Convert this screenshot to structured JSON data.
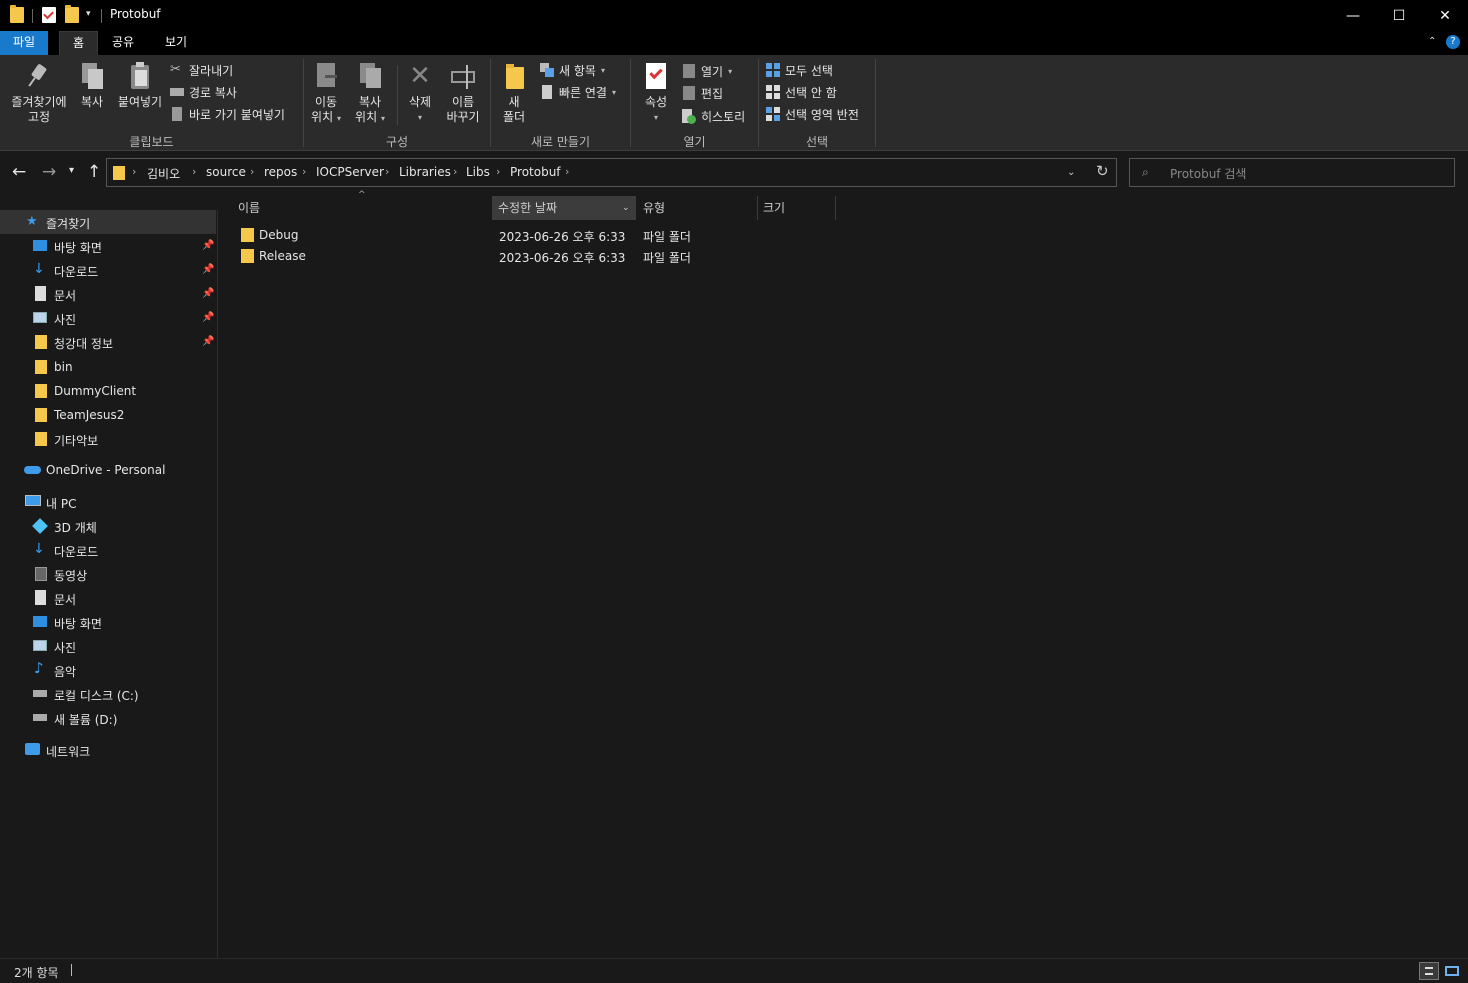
{
  "window": {
    "title": "Protobuf"
  },
  "tabs": [
    "파일",
    "홈",
    "공유",
    "보기"
  ],
  "ribbon": {
    "clipboard": {
      "pin_line1": "즐겨찾기에",
      "pin_line2": "고정",
      "copy": "복사",
      "paste": "붙여넣기",
      "cut": "잘라내기",
      "copy_path": "경로 복사",
      "paste_shortcut": "바로 가기 붙여넣기",
      "label": "클립보드"
    },
    "organize": {
      "move_line1": "이동",
      "move_line2": "위치",
      "copyto_line1": "복사",
      "copyto_line2": "위치",
      "delete": "삭제",
      "rename_line1": "이름",
      "rename_line2": "바꾸기",
      "label": "구성"
    },
    "new": {
      "folder_line1": "새",
      "folder_line2": "폴더",
      "new_item": "새 항목",
      "easy_access": "빠른 연결",
      "label": "새로 만들기"
    },
    "open": {
      "properties": "속성",
      "open": "열기",
      "edit": "편집",
      "history": "히스토리",
      "label": "열기"
    },
    "select": {
      "select_all": "모두 선택",
      "select_none": "선택 안 함",
      "invert": "선택 영역 반전",
      "label": "선택"
    }
  },
  "breadcrumb": [
    "김비오",
    "source",
    "repos",
    "IOCPServer",
    "Libraries",
    "Libs",
    "Protobuf"
  ],
  "search": {
    "placeholder": "Protobuf 검색"
  },
  "navpane": {
    "quick_access": "즐겨찾기",
    "quick_items": [
      "바탕 화면",
      "다운로드",
      "문서",
      "사진",
      "청강대 정보",
      "bin",
      "DummyClient",
      "TeamJesus2",
      "기타악보"
    ],
    "onedrive": "OneDrive - Personal",
    "this_pc": "내 PC",
    "pc_items": [
      "3D 개체",
      "다운로드",
      "동영상",
      "문서",
      "바탕 화면",
      "사진",
      "음악",
      "로컬 디스크 (C:)",
      "새 볼륨 (D:)"
    ],
    "network": "네트워크"
  },
  "columns": {
    "name": "이름",
    "date": "수정한 날짜",
    "type": "유형",
    "size": "크기"
  },
  "files": [
    {
      "name": "Debug",
      "date": "2023-06-26 오후 6:33",
      "type": "파일 폴더"
    },
    {
      "name": "Release",
      "date": "2023-06-26 오후 6:33",
      "type": "파일 폴더"
    }
  ],
  "status": {
    "count": "2개 항목"
  },
  "colors": {
    "accent": "#1979ca",
    "folder": "#f5c84c"
  }
}
